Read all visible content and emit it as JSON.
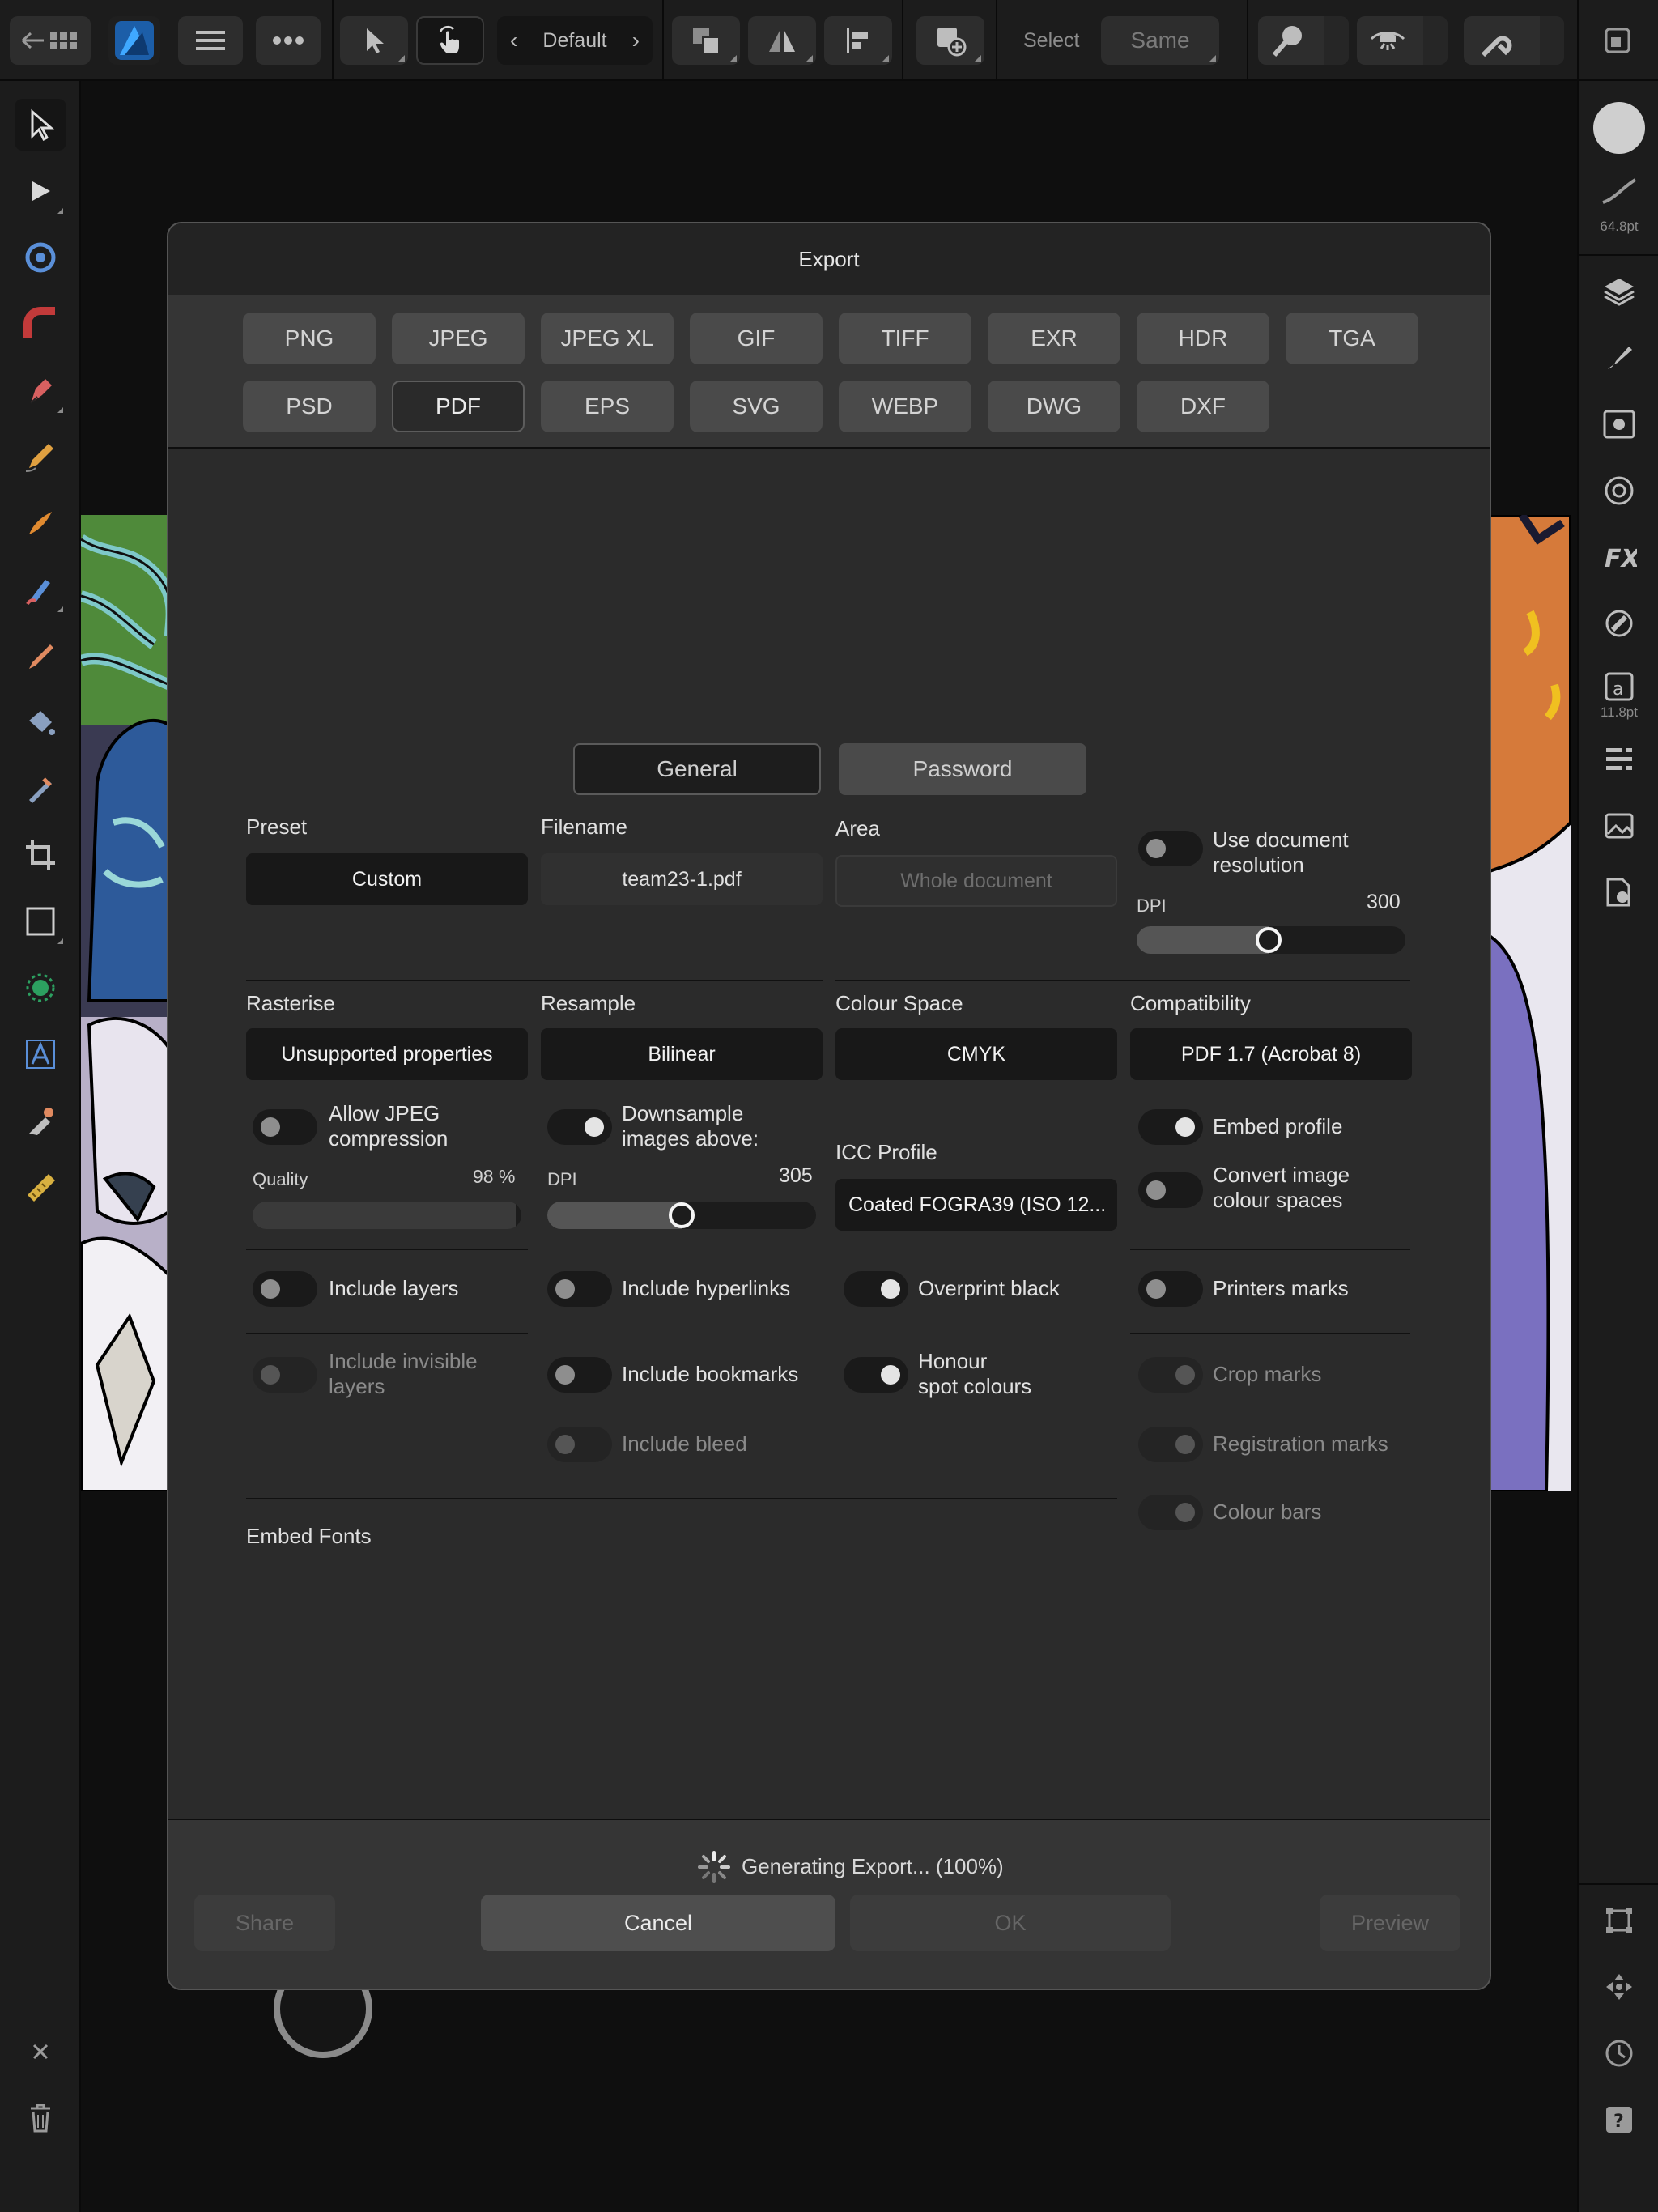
{
  "toolbar": {
    "persona_label": "Default",
    "select_label": "Select",
    "same_label": "Same"
  },
  "right_panel": {
    "stroke_size": "64.8pt",
    "font_size": "11.8pt"
  },
  "dialog": {
    "title": "Export",
    "formats_row1": [
      "PNG",
      "JPEG",
      "JPEG XL",
      "GIF",
      "TIFF",
      "EXR",
      "HDR",
      "TGA"
    ],
    "formats_row2": [
      "PSD",
      "PDF",
      "EPS",
      "SVG",
      "WEBP",
      "DWG",
      "DXF"
    ],
    "selected_format": "PDF",
    "tabs": {
      "general": "General",
      "password": "Password",
      "active": "General"
    },
    "preset": {
      "label": "Preset",
      "value": "Custom"
    },
    "filename": {
      "label": "Filename",
      "value": "team23-1.pdf"
    },
    "area": {
      "label": "Area",
      "value": "Whole document"
    },
    "use_doc_res": {
      "label": "Use document\nresolution",
      "on": false
    },
    "dpi": {
      "label": "DPI",
      "value": "300",
      "fraction": 0.49
    },
    "rasterise": {
      "label": "Rasterise",
      "value": "Unsupported properties"
    },
    "resample": {
      "label": "Resample",
      "value": "Bilinear"
    },
    "colour_space": {
      "label": "Colour Space",
      "value": "CMYK"
    },
    "compatibility": {
      "label": "Compatibility",
      "value": "PDF 1.7 (Acrobat 8)"
    },
    "allow_jpeg": {
      "label": "Allow JPEG\ncompression",
      "on": false
    },
    "quality": {
      "label": "Quality",
      "value": "98 %",
      "fraction": 0.98
    },
    "downsample": {
      "label": "Downsample\nimages above:",
      "on": true
    },
    "downsample_dpi": {
      "label": "DPI",
      "value": "305",
      "fraction": 0.5
    },
    "icc": {
      "label": "ICC Profile",
      "value": "Coated FOGRA39 (ISO 12..."
    },
    "embed_profile": {
      "label": "Embed profile",
      "on": true
    },
    "convert_image": {
      "label": "Convert image\ncolour spaces",
      "on": false
    },
    "include_layers": {
      "label": "Include layers",
      "on": false
    },
    "include_hyperlinks": {
      "label": "Include hyperlinks",
      "on": false
    },
    "overprint_black": {
      "label": "Overprint black",
      "on": true
    },
    "printers_marks": {
      "label": "Printers marks",
      "on": false
    },
    "include_invisible": {
      "label": "Include invisible\nlayers",
      "on": false
    },
    "include_bookmarks": {
      "label": "Include bookmarks",
      "on": false
    },
    "honour_spot": {
      "label": "Honour\nspot colours",
      "on": true
    },
    "crop_marks": {
      "label": "Crop marks",
      "on": false
    },
    "include_bleed": {
      "label": "Include bleed",
      "on": false
    },
    "registration_marks": {
      "label": "Registration marks",
      "on": false
    },
    "colour_bars": {
      "label": "Colour bars",
      "on": false
    },
    "embed_fonts": {
      "label": "Embed Fonts"
    },
    "progress_text": "Generating Export... (100%)",
    "buttons": {
      "share": "Share",
      "cancel": "Cancel",
      "ok": "OK",
      "preview": "Preview"
    }
  }
}
